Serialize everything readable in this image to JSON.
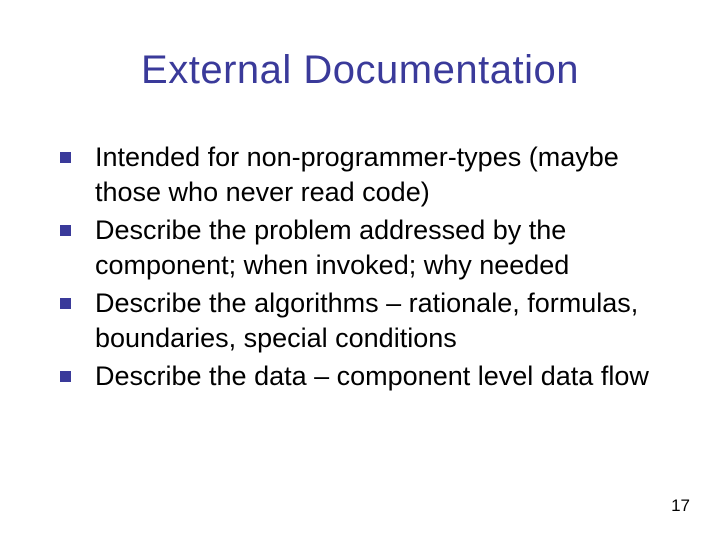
{
  "title": "External Documentation",
  "bullets": [
    "Intended for non-programmer-types (maybe those who never read code)",
    "Describe the problem addressed by the component; when invoked; why needed",
    "Describe the algorithms – rationale, formulas, boundaries, special conditions",
    "Describe the data – component level data flow"
  ],
  "page_number": "17"
}
